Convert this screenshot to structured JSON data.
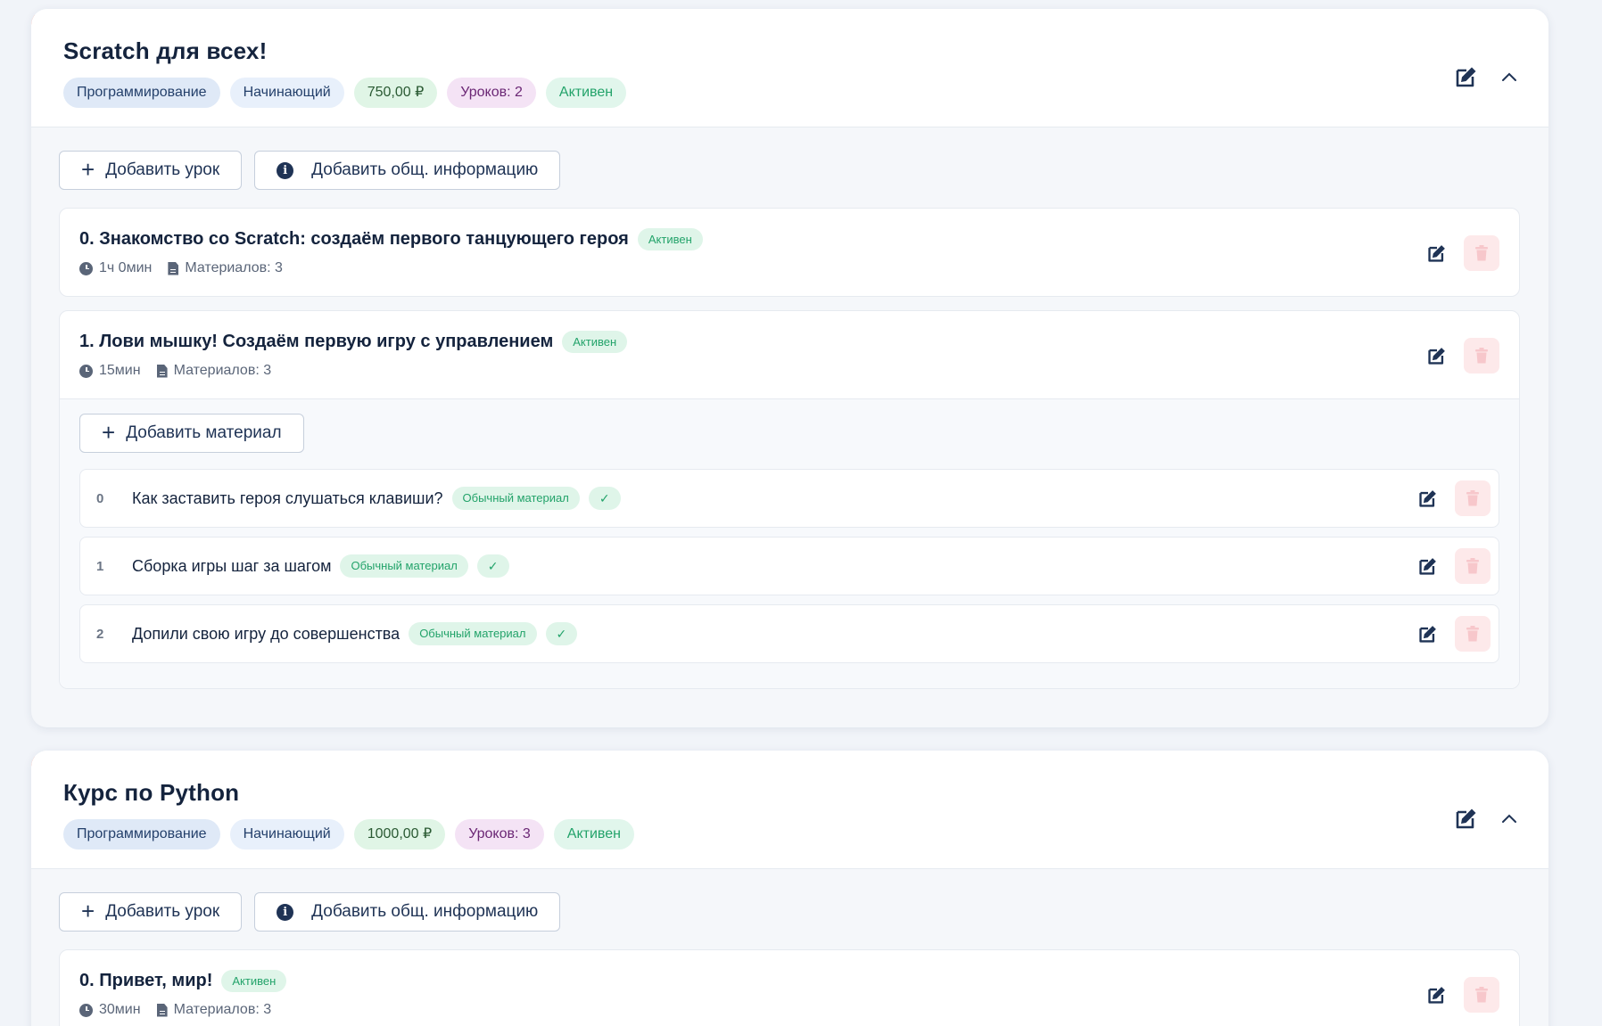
{
  "courses": [
    {
      "title": "Scratch для всех!",
      "tags": {
        "category": "Программирование",
        "level": "Начинающий",
        "price": "750,00 ₽",
        "lessons_count": "Уроков: 2",
        "status": "Активен"
      },
      "actions": {
        "add_lesson": "Добавить урок",
        "add_info": "Добавить общ. информацию"
      },
      "lessons": [
        {
          "title": "0. Знакомство со Scratch: создаём первого танцующего героя",
          "status": "Активен",
          "duration": "1ч 0мин",
          "materials": "Материалов: 3"
        },
        {
          "title": "1. Лови мышку! Создаём первую игру с управлением",
          "status": "Активен",
          "duration": "15мин",
          "materials": "Материалов: 3",
          "add_material": "Добавить материал",
          "material_items": [
            {
              "num": "0",
              "title": "Как заставить героя слушаться клавиши?",
              "type": "Обычный материал",
              "check": "✓"
            },
            {
              "num": "1",
              "title": "Сборка игры шаг за шагом",
              "type": "Обычный материал",
              "check": "✓"
            },
            {
              "num": "2",
              "title": "Допили свою игру до совершенства",
              "type": "Обычный материал",
              "check": "✓"
            }
          ]
        }
      ]
    },
    {
      "title": "Курс по Python",
      "tags": {
        "category": "Программирование",
        "level": "Начинающий",
        "price": "1000,00 ₽",
        "lessons_count": "Уроков: 3",
        "status": "Активен"
      },
      "actions": {
        "add_lesson": "Добавить урок",
        "add_info": "Добавить общ. информацию"
      },
      "lessons": [
        {
          "title": "0. Привет, мир!",
          "status": "Активен",
          "duration": "30мин",
          "materials": "Материалов: 3"
        }
      ]
    }
  ],
  "colors": {
    "accent_bar": "#ec6650",
    "status_green": "#23a36a",
    "icon_navy": "#1f3355",
    "trash_bg": "#fde9ea"
  },
  "icons": {
    "edit": "edit-icon",
    "collapse": "chevron-up-icon",
    "delete": "trash-icon",
    "add": "plus-icon",
    "info": "info-icon",
    "clock": "clock-icon",
    "doc": "document-icon"
  }
}
